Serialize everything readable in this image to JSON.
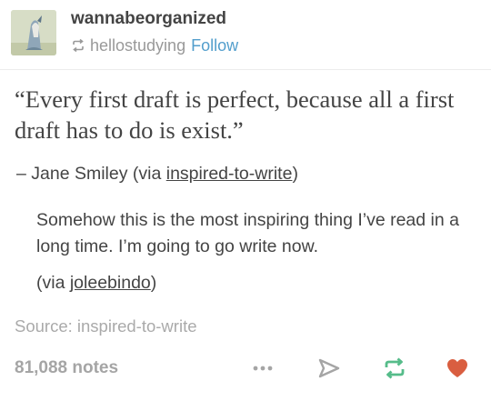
{
  "post": {
    "blog_name": "wannabeorganized",
    "reblogged_from": "hellostudying",
    "follow_label": "Follow",
    "quote_text": "“Every first draft is perfect, because all a first draft has to do is exist.”",
    "attribution": {
      "prefix": "– Jane Smiley (via ",
      "link": "inspired-to-write",
      "suffix": ")"
    },
    "comment": "Somehow this is the most inspiring thing I’ve read in a long time. I’m going to go write now.",
    "via": {
      "prefix": "(via ",
      "link": "joleebindo",
      "suffix": ")"
    },
    "source": "Source: inspired-to-write",
    "notes": "81,088 notes"
  },
  "actions": {
    "more": "more-dots-icon",
    "share": "share-paper-plane-icon",
    "reblog": "reblog-icon",
    "like": "heart-icon"
  },
  "colors": {
    "follow_link": "#529ecc",
    "reblog_green": "#56bc8a",
    "like_heart": "#d95e40",
    "muted_text": "#a5a5a5",
    "body_text": "#444444"
  }
}
